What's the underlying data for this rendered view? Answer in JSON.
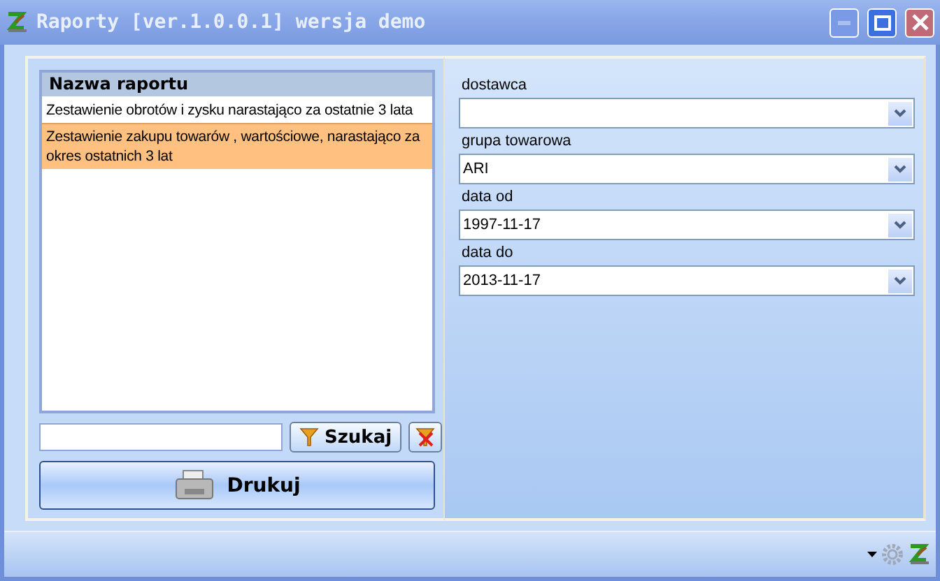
{
  "window": {
    "title": "Raporty [ver.1.0.0.1] wersja demo"
  },
  "report_list": {
    "column": "Nazwa raportu",
    "rows": [
      {
        "name": "Zestawienie obrotów i zysku narastająco za ostatnie 3 lata",
        "selected": false
      },
      {
        "name": "Zestawienie zakupu towarów ,  wartościowe, narastająco za okres ostatnich 3 lat",
        "selected": true
      }
    ]
  },
  "search": {
    "button": "Szukaj"
  },
  "print_button": "Drukuj",
  "filters": [
    {
      "label": "dostawca"
    },
    {
      "label": "grupa towarowa",
      "value": "ARI"
    },
    {
      "label": "data od",
      "value": "1997-11-17"
    },
    {
      "label": "data do",
      "value": "2013-11-17"
    }
  ]
}
